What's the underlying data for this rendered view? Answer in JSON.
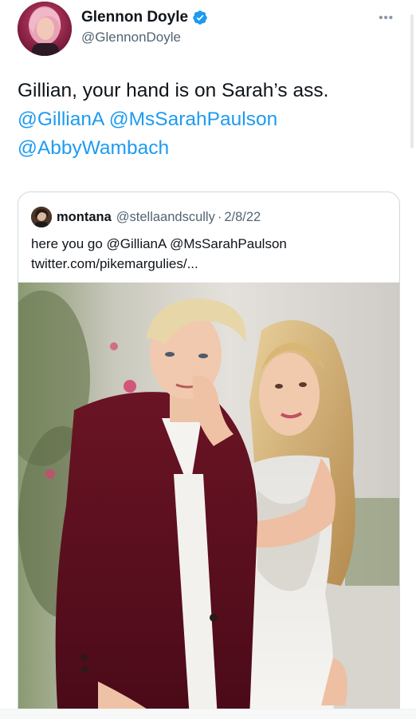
{
  "tweet": {
    "author": {
      "display_name": "Glennon Doyle",
      "handle": "@GlennonDoyle",
      "verified": true
    },
    "text_line1": "Gillian, your hand is on Sarah’s ass.",
    "mentions": [
      "@GillianA",
      "@MsSarahPaulson",
      "@AbbyWambach"
    ],
    "more_icon": "ellipsis-icon"
  },
  "quote": {
    "author": {
      "display_name": "montana",
      "handle": "@stellaandscully",
      "date": "2/8/22"
    },
    "separator": "·",
    "text_line1": "here you go @GillianA @MsSarahPaulson",
    "text_line2": "twitter.com/pikemargulies/...",
    "photo_icon": "wedding-photo-image"
  },
  "colors": {
    "link": "#1d9bf0",
    "verified": "#1d9bf0",
    "secondary": "#536471",
    "text": "#0f1419"
  }
}
